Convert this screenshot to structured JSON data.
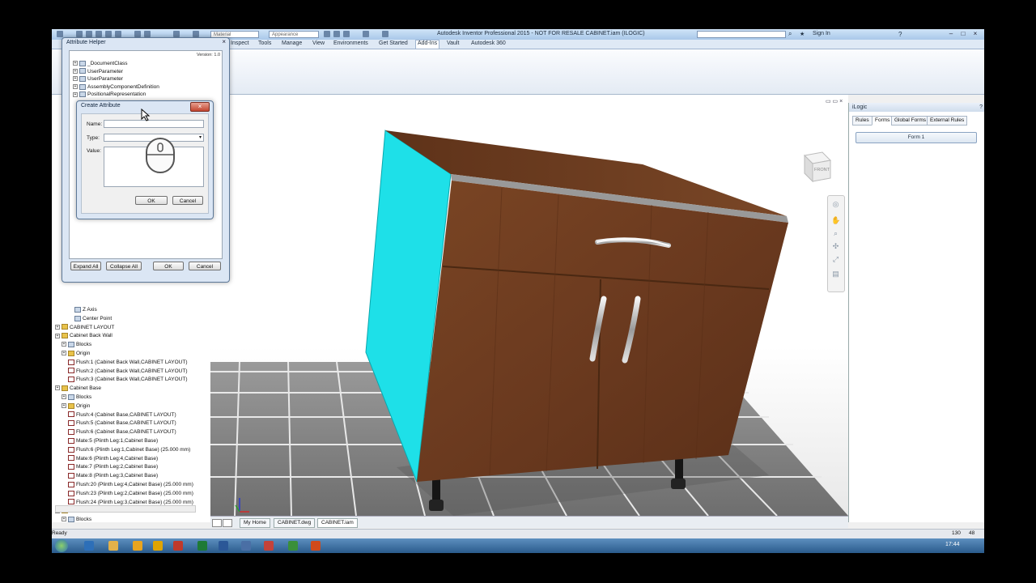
{
  "window": {
    "title": "Autodesk Inventor Professional 2015 - NOT FOR RESALE    CABINET.iam (ILOGIC)",
    "signin": "Sign In",
    "material_placeholder": "Material",
    "appearance_placeholder": "Appearance"
  },
  "ribbon": {
    "tabs": [
      "Inspect",
      "Tools",
      "Manage",
      "View",
      "Environments",
      "Get Started",
      "Add-Ins",
      "Vault",
      "Autodesk 360"
    ],
    "active_tab": "Add-Ins"
  },
  "attribute_helper": {
    "title": "Attribute Helper",
    "version": "Version: 1.0",
    "items": [
      "_DocumentClass",
      "UserParameter",
      "UserParameter",
      "AssemblyComponentDefinition",
      "PositionalRepresentation"
    ],
    "expand_all": "Expand All",
    "collapse_all": "Collapse All",
    "ok": "OK",
    "cancel": "Cancel"
  },
  "create_attribute": {
    "title": "Create Attribute",
    "name_label": "Name:",
    "type_label": "Type:",
    "value_label": "Value:",
    "ok": "OK",
    "cancel": "Cancel"
  },
  "browser_tree": [
    {
      "label": "Z Axis",
      "indent": 3,
      "icon": "axis"
    },
    {
      "label": "Center Point",
      "indent": 3,
      "icon": "point"
    },
    {
      "label": "CABINET LAYOUT",
      "indent": 0,
      "icon": "folder"
    },
    {
      "label": "Cabinet Back Wall",
      "indent": 0,
      "icon": "folder"
    },
    {
      "label": "Blocks",
      "indent": 1,
      "icon": "part"
    },
    {
      "label": "Origin",
      "indent": 1,
      "icon": "folder"
    },
    {
      "label": "Flush:1 (Cabinet Back Wall,CABINET LAYOUT)",
      "indent": 2,
      "icon": "constraint"
    },
    {
      "label": "Flush:2 (Cabinet Back Wall,CABINET LAYOUT)",
      "indent": 2,
      "icon": "constraint"
    },
    {
      "label": "Flush:3 (Cabinet Back Wall,CABINET LAYOUT)",
      "indent": 2,
      "icon": "constraint"
    },
    {
      "label": "Cabinet Base",
      "indent": 0,
      "icon": "folder"
    },
    {
      "label": "Blocks",
      "indent": 1,
      "icon": "part"
    },
    {
      "label": "Origin",
      "indent": 1,
      "icon": "folder"
    },
    {
      "label": "Flush:4 (Cabinet Base,CABINET LAYOUT)",
      "indent": 2,
      "icon": "constraint"
    },
    {
      "label": "Flush:5 (Cabinet Base,CABINET LAYOUT)",
      "indent": 2,
      "icon": "constraint"
    },
    {
      "label": "Flush:6 (Cabinet Base,CABINET LAYOUT)",
      "indent": 2,
      "icon": "constraint"
    },
    {
      "label": "Mate:5 (Plinth Leg:1,Cabinet Base)",
      "indent": 2,
      "icon": "constraint"
    },
    {
      "label": "Flush:6 (Plinth Leg:1,Cabinet Base) (25.000 mm)",
      "indent": 2,
      "icon": "constraint"
    },
    {
      "label": "Mate:6 (Plinth Leg:4,Cabinet Base)",
      "indent": 2,
      "icon": "constraint"
    },
    {
      "label": "Mate:7 (Plinth Leg:2,Cabinet Base)",
      "indent": 2,
      "icon": "constraint"
    },
    {
      "label": "Mate:8 (Plinth Leg:3,Cabinet Base)",
      "indent": 2,
      "icon": "constraint"
    },
    {
      "label": "Flush:20 (Plinth Leg:4,Cabinet Base) (25.000 mm)",
      "indent": 2,
      "icon": "constraint"
    },
    {
      "label": "Flush:23 (Plinth Leg:2,Cabinet Base) (25.000 mm)",
      "indent": 2,
      "icon": "constraint"
    },
    {
      "label": "Flush:24 (Plinth Leg:3,Cabinet Base) (25.000 mm)",
      "indent": 2,
      "icon": "constraint"
    },
    {
      "label": "Cabinet LHS WALL",
      "indent": 0,
      "icon": "folder"
    },
    {
      "label": "Blocks",
      "indent": 1,
      "icon": "part"
    }
  ],
  "document_tabs": [
    "My Home",
    "CABINET.dwg",
    "CABINET.iam"
  ],
  "active_document": "CABINET.iam",
  "viewcube_label": "FRONT",
  "ilogic": {
    "title": "iLogic",
    "tabs": [
      "Rules",
      "Forms",
      "Global Forms",
      "External Rules"
    ],
    "active_tab": "Forms",
    "form_button": "Form 1"
  },
  "status": {
    "text": "Ready",
    "count1": "130",
    "count2": "48"
  },
  "taskbar": {
    "clock": "17:44"
  },
  "colors": {
    "cabinet_side": "#1ee0e8",
    "wood": "#6b3a1f",
    "ribbon_bg": "#dfe9f5"
  }
}
